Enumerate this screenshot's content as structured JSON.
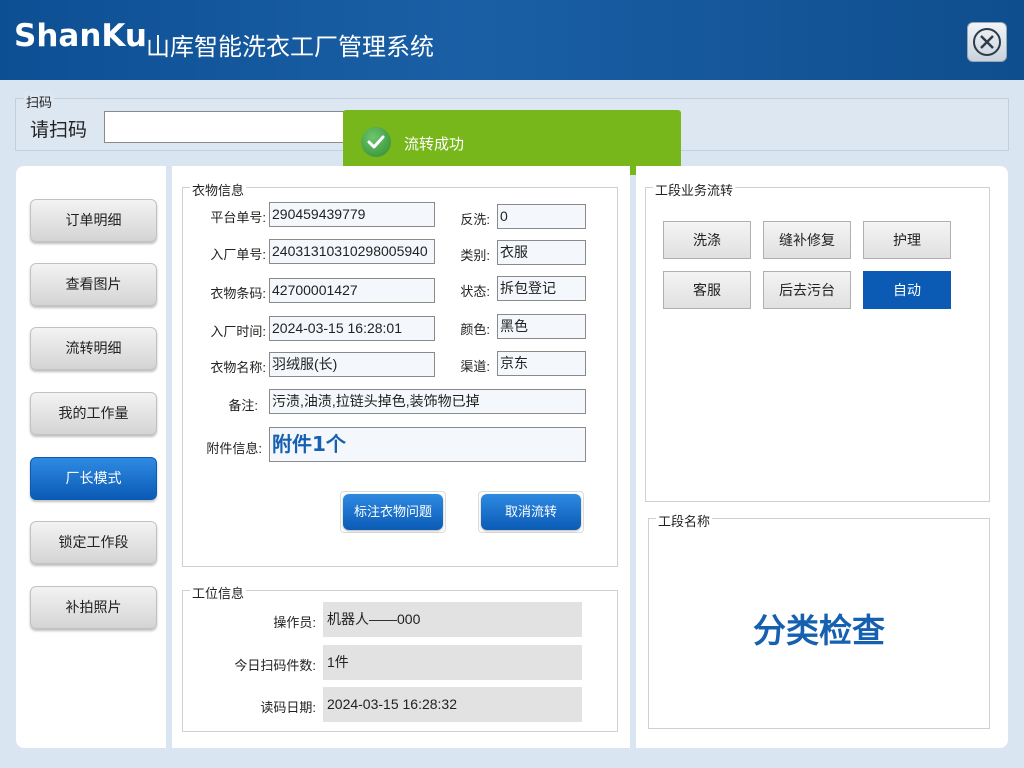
{
  "header": {
    "logo": "ShanKu",
    "title": "山库智能洗衣工厂管理系统"
  },
  "scan": {
    "group_title": "扫码",
    "label": "请扫码",
    "value": ""
  },
  "toast": {
    "message": "流转成功"
  },
  "sidebar": {
    "items": [
      "订单明细",
      "查看图片",
      "流转明细",
      "我的工作量",
      "厂长模式",
      "锁定工作段",
      "补拍照片"
    ],
    "active_index": 4
  },
  "garment": {
    "group_title": "衣物信息",
    "fields": {
      "platform_order": {
        "label": "平台单号:",
        "value": "290459439779"
      },
      "rewash": {
        "label": "反洗:",
        "value": "0"
      },
      "factory_order": {
        "label": "入厂单号:",
        "value": "24031310310298005940"
      },
      "category": {
        "label": "类别:",
        "value": "衣服"
      },
      "barcode": {
        "label": "衣物条码:",
        "value": "42700001427"
      },
      "status": {
        "label": "状态:",
        "value": "拆包登记"
      },
      "entry_time": {
        "label": "入厂时间:",
        "value": "2024-03-15 16:28:01"
      },
      "color": {
        "label": "颜色:",
        "value": "黑色"
      },
      "name": {
        "label": "衣物名称:",
        "value": "羽绒服(长)"
      },
      "channel": {
        "label": "渠道:",
        "value": "京东"
      },
      "remark": {
        "label": "备注:",
        "value": "污渍,油渍,拉链头掉色,装饰物已掉"
      },
      "attachment": {
        "label": "附件信息:",
        "value": "附件1个"
      }
    },
    "buttons": {
      "mark_issue": "标注衣物问题",
      "cancel_flow": "取消流转"
    }
  },
  "station": {
    "group_title": "工位信息",
    "operator": {
      "label": "操作员:",
      "value": "机器人——000"
    },
    "today_count": {
      "label": "今日扫码件数:",
      "value": "1件"
    },
    "read_date": {
      "label": "读码日期:",
      "value": "2024-03-15 16:28:32"
    }
  },
  "stage_flow": {
    "group_title": "工段业务流转",
    "buttons": [
      "洗涤",
      "缝补修复",
      "护理",
      "客服",
      "后去污台",
      "自动"
    ],
    "active_index": 5
  },
  "stage_name": {
    "group_title": "工段名称",
    "value": "分类检查"
  },
  "colors": {
    "header_blue": "#1a5fa5",
    "accent_blue": "#0b5bb5",
    "toast_green": "#78b71b",
    "stage_text": "#1660b0"
  }
}
